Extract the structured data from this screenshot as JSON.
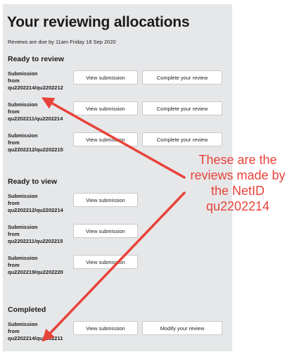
{
  "page": {
    "title": "Your reviewing allocations",
    "due_text": "Reviews are due by 11am Friday 18 Sep 2020"
  },
  "sections": [
    {
      "heading": "Ready to review",
      "items": [
        {
          "label_line1": "Submission",
          "label_line2": "from",
          "label_line3": "qu2202214/qu2202212",
          "view_label": "View submission",
          "action_label": "Complete your review"
        },
        {
          "label_line1": "Submission",
          "label_line2": "from",
          "label_line3": "qu2202211/qu2202214",
          "view_label": "View submission",
          "action_label": "Complete your review"
        },
        {
          "label_line1": "Submission",
          "label_line2": "from",
          "label_line3": "qu2202212/qu2202215",
          "view_label": "View submission",
          "action_label": "Complete your review"
        }
      ]
    },
    {
      "heading": "Ready to view",
      "items": [
        {
          "label_line1": "Submission",
          "label_line2": "from",
          "label_line3": "qu2202212/qu2202214",
          "view_label": "View submission"
        },
        {
          "label_line1": "Submission",
          "label_line2": "from",
          "label_line3": "qu2202211/qu2202215",
          "view_label": "View submission"
        },
        {
          "label_line1": "Submission",
          "label_line2": "from",
          "label_line3": "qu2202219/qu2202220",
          "view_label": "View submission"
        }
      ]
    },
    {
      "heading": "Completed",
      "items": [
        {
          "label_line1": "Submission",
          "label_line2": "from",
          "label_line3": "qu2202214/qu2202211",
          "view_label": "View submission",
          "action_label": "Modify your review"
        }
      ]
    }
  ],
  "annotation": {
    "line1": "These are the",
    "line2": "reviews made by",
    "line3": "the NetID",
    "line4": "qu2202214",
    "color": "#e8433a"
  }
}
